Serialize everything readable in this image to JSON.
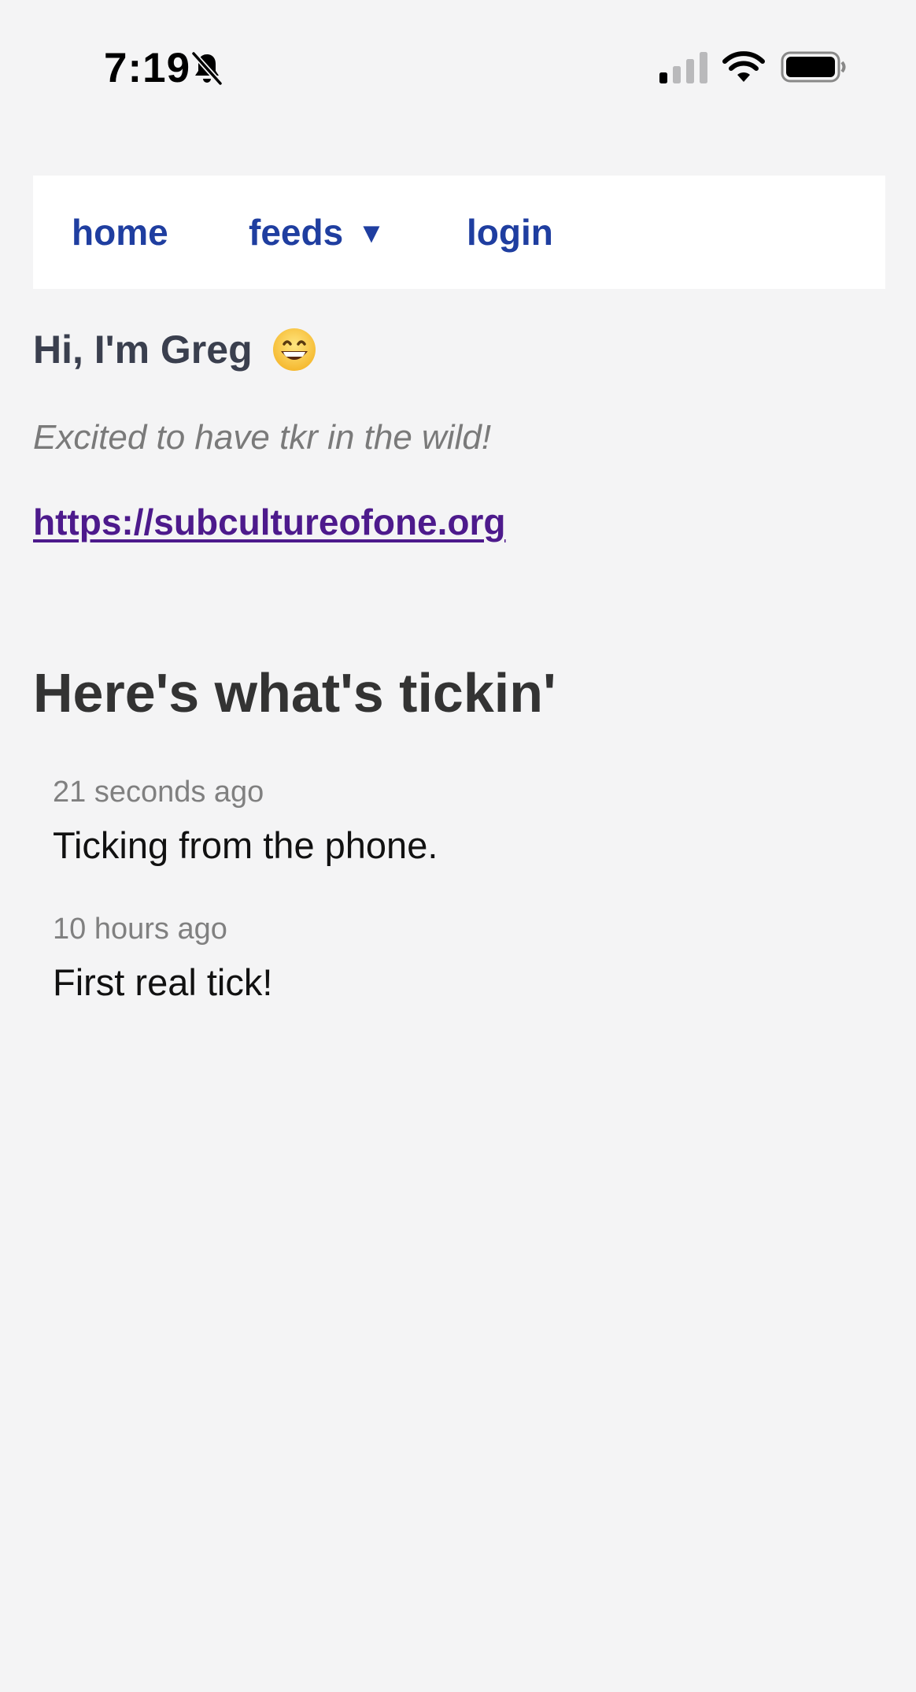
{
  "status_bar": {
    "time": "7:19",
    "icons": [
      "bell-slash-icon",
      "cellular-signal-icon",
      "wifi-icon",
      "battery-icon"
    ]
  },
  "nav": {
    "items": [
      {
        "label": "home"
      },
      {
        "label": "feeds",
        "icon": "caret-down-icon",
        "caret": "▼"
      },
      {
        "label": "login"
      }
    ],
    "link_color": "#1f3ea0"
  },
  "profile": {
    "greeting": "Hi, I'm Greg",
    "emoji_icon": "grinning-face-icon",
    "bio": "Excited to have tkr in the wild!",
    "url": "https://subcultureofone.org",
    "url_color": "#4d1a8c"
  },
  "feed": {
    "heading": "Here's what's tickin'",
    "ticks": [
      {
        "time": "21 seconds ago",
        "text": "Ticking from the phone."
      },
      {
        "time": "10 hours ago",
        "text": "First real tick!"
      }
    ]
  },
  "colors": {
    "background": "#f4f4f5",
    "nav_background": "#ffffff"
  }
}
